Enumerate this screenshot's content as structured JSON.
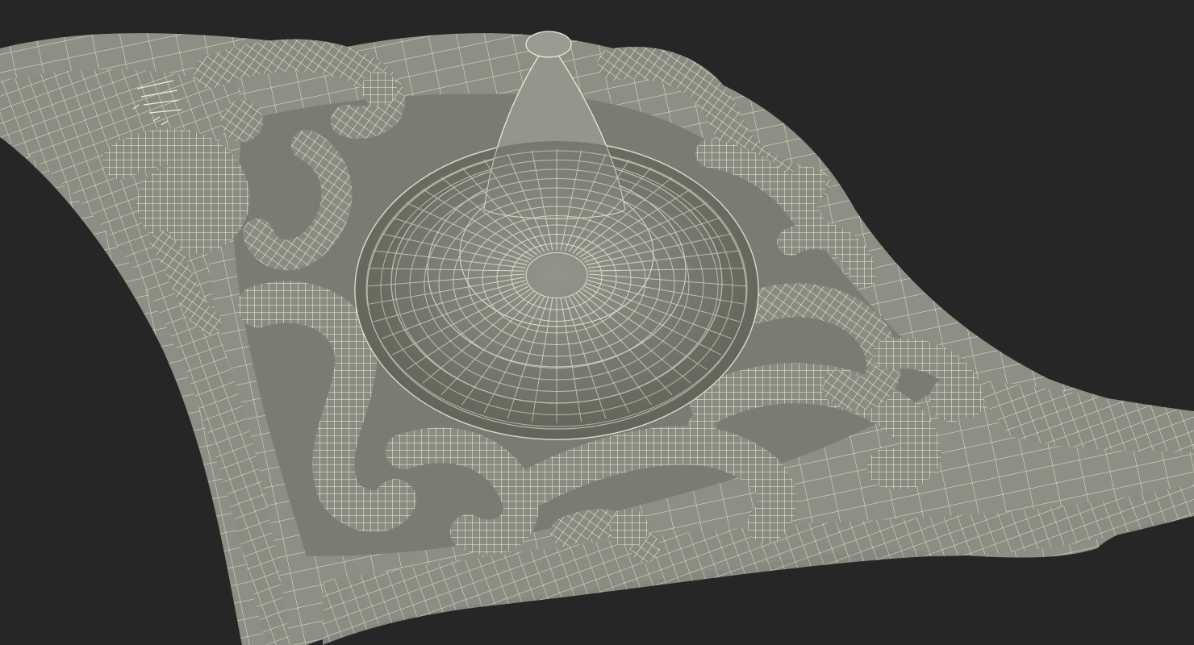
{
  "scene": {
    "subject": "ornate-carved-wireframe-mesh",
    "colors": {
      "background": "#262626",
      "surface": "#8a8b80",
      "surface_dark": "#6f7068",
      "surface_light": "#9c9d92",
      "wire": "#efeedd",
      "wire_soft": "#d9d8c6",
      "shadow": "#55564f"
    }
  }
}
